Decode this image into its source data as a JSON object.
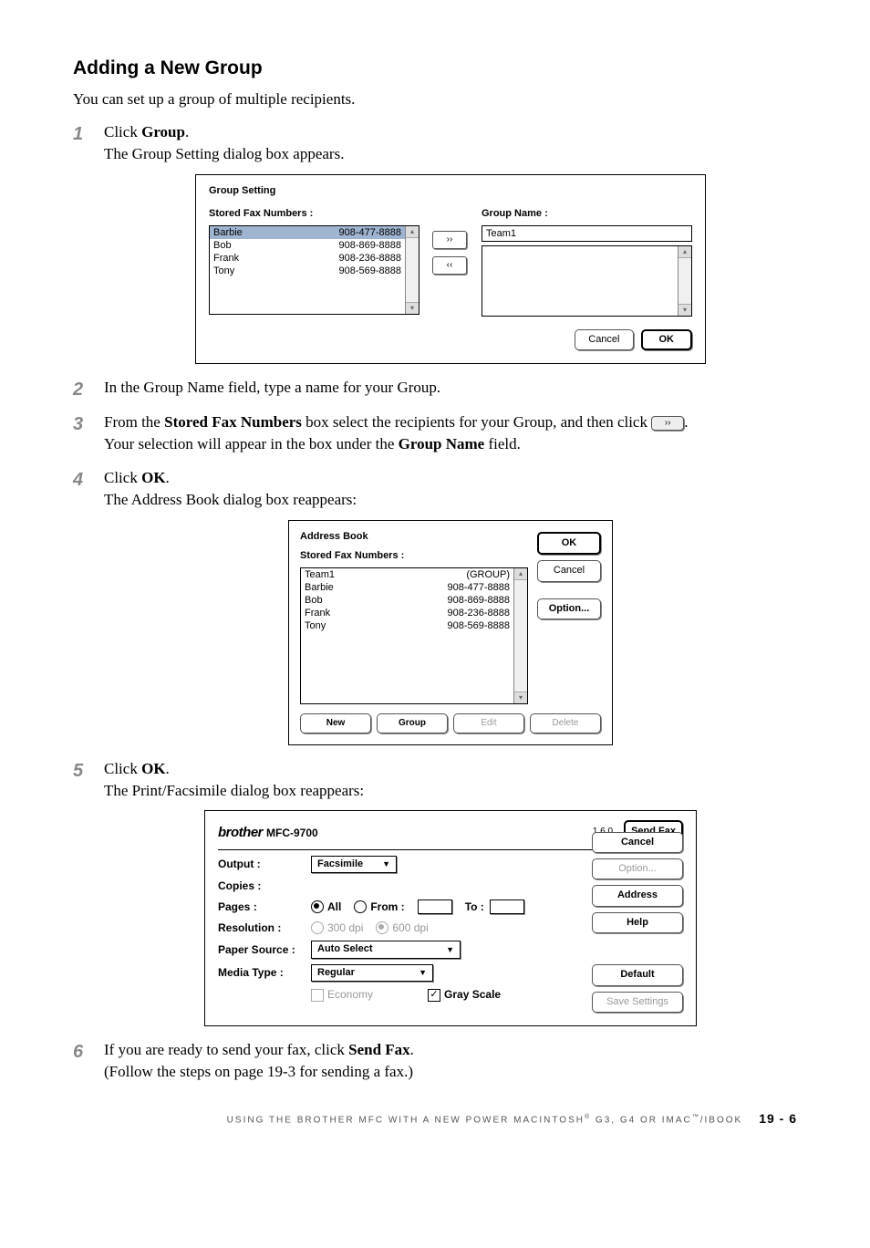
{
  "heading": "Adding a New Group",
  "intro": "You can set up a group of multiple recipients.",
  "steps": {
    "s1_a": "Click ",
    "s1_b": "Group",
    "s1_c": ".",
    "s1_line2": "The Group Setting dialog box appears.",
    "s2": "In the Group Name field, type a name for your Group.",
    "s3_a": "From the ",
    "s3_b": "Stored Fax Numbers",
    "s3_c": " box select the recipients for your Group, and then click ",
    "s3_d": ".",
    "s3_line2_a": "Your selection will appear in the box under the ",
    "s3_line2_b": "Group Name",
    "s3_line2_c": " field.",
    "s4_a": "Click ",
    "s4_b": "OK",
    "s4_c": ".",
    "s4_line2": "The Address Book dialog box reappears:",
    "s5_a": "Click ",
    "s5_b": "OK",
    "s5_c": ".",
    "s5_line2": "The Print/Facsimile dialog box reappears:",
    "s6_a": "If you are ready to send your fax, click ",
    "s6_b": "Send Fax",
    "s6_c": ".",
    "s6_line2": "(Follow the steps on page 19-3 for sending a fax.)"
  },
  "inline_btn": "››",
  "group_setting": {
    "title": "Group Setting",
    "stored_label": "Stored Fax Numbers :",
    "stored_rows": [
      {
        "name": "Barbie",
        "num": "908-477-8888"
      },
      {
        "name": "Bob",
        "num": "908-869-8888"
      },
      {
        "name": "Frank",
        "num": "908-236-8888"
      },
      {
        "name": "Tony",
        "num": "908-569-8888"
      }
    ],
    "move_right": "››",
    "move_left": "‹‹",
    "group_name_label": "Group Name :",
    "group_name_value": "Team1",
    "cancel": "Cancel",
    "ok": "OK"
  },
  "address_book": {
    "title": "Address Book",
    "stored_label": "Stored Fax Numbers :",
    "rows": [
      {
        "name": "Team1",
        "num": "(GROUP)"
      },
      {
        "name": "Barbie",
        "num": "908-477-8888"
      },
      {
        "name": "Bob",
        "num": "908-869-8888"
      },
      {
        "name": "Frank",
        "num": "908-236-8888"
      },
      {
        "name": "Tony",
        "num": "908-569-8888"
      }
    ],
    "ok": "OK",
    "cancel": "Cancel",
    "option": "Option...",
    "new": "New",
    "group": "Group",
    "edit": "Edit",
    "delete": "Delete"
  },
  "print_fax": {
    "brand": "brother",
    "model": "MFC-9700",
    "version": "1.6.0",
    "send_fax": "Send Fax",
    "cancel": "Cancel",
    "option": "Option...",
    "address": "Address",
    "help": "Help",
    "default": "Default",
    "save_settings": "Save Settings",
    "output_label": "Output :",
    "output_value": "Facsimile",
    "copies_label": "Copies :",
    "pages_label": "Pages :",
    "pages_all": "All",
    "pages_from": "From :",
    "pages_to": "To :",
    "resolution_label": "Resolution :",
    "res_300": "300 dpi",
    "res_600": "600 dpi",
    "paper_source_label": "Paper Source :",
    "paper_source_value": "Auto Select",
    "media_type_label": "Media Type :",
    "media_type_value": "Regular",
    "economy": "Economy",
    "gray_scale": "Gray Scale"
  },
  "footer": {
    "text_a": "USING THE BROTHER MFC WITH A NEW POWER MACINTOSH",
    "reg": "®",
    "text_b": " G3, G4 OR IMAC",
    "tm": "™",
    "text_c": "/IBOOK",
    "page": "19 - 6"
  }
}
